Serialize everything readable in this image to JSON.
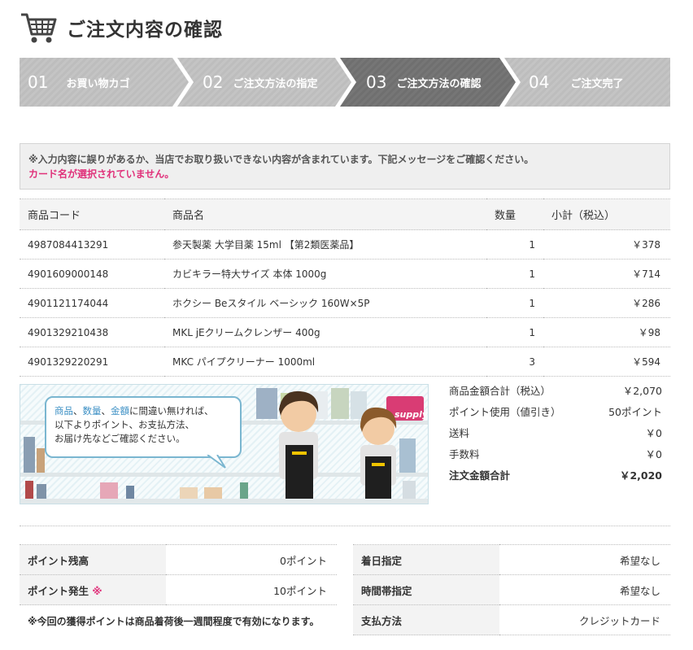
{
  "page": {
    "title": "ご注文内容の確認"
  },
  "steps": [
    {
      "num": "01",
      "label": "お買い物カゴ",
      "active": false
    },
    {
      "num": "02",
      "label": "ご注文方法の指定",
      "active": false
    },
    {
      "num": "03",
      "label": "ご注文方法の確認",
      "active": true
    },
    {
      "num": "04",
      "label": "ご注文完了",
      "active": false
    }
  ],
  "alert": {
    "message": "※入力内容に誤りがあるか、当店でお取り扱いできない内容が含まれています。下記メッセージをご確認ください。",
    "error": "カード名が選択されていません。"
  },
  "items": {
    "headers": {
      "code": "商品コード",
      "name": "商品名",
      "qty": "数量",
      "subtotal": "小計（税込）"
    },
    "rows": [
      {
        "code": "4987084413291",
        "name": "参天製薬 大学目薬 15ml 【第2類医薬品】",
        "qty": "1",
        "subtotal": "￥378"
      },
      {
        "code": "4901609000148",
        "name": "カビキラー特大サイズ 本体 1000g",
        "qty": "1",
        "subtotal": "￥714"
      },
      {
        "code": "4901121174044",
        "name": "ホクシー Beスタイル ベーシック 160W×5P",
        "qty": "1",
        "subtotal": "￥286"
      },
      {
        "code": "4901329210438",
        "name": "MKL jEクリームクレンザー 400g",
        "qty": "1",
        "subtotal": "￥98"
      },
      {
        "code": "4901329220291",
        "name": "MKC パイプクリーナー 1000ml",
        "qty": "3",
        "subtotal": "￥594"
      }
    ]
  },
  "banner": {
    "bubble_hl1": "商品",
    "bubble_sep1": "、",
    "bubble_hl2": "数量",
    "bubble_sep2": "、",
    "bubble_hl3": "金額",
    "bubble_rest1": "に間違い無ければ、",
    "bubble_line2": "以下よりポイント、お支払方法、",
    "bubble_line3": "お届け先などご確認ください。",
    "shelf_text": "supply"
  },
  "totals": [
    {
      "label": "商品金額合計（税込）",
      "value": "￥2,070"
    },
    {
      "label": "ポイント使用（値引き）",
      "value": "50ポイント"
    },
    {
      "label": "送料",
      "value": "￥0"
    },
    {
      "label": "手数料",
      "value": "￥0"
    },
    {
      "label": "注文金額合計",
      "value": "￥2,020"
    }
  ],
  "points": {
    "balance_label": "ポイント残高",
    "balance_value": "0ポイント",
    "earned_label": "ポイント発生",
    "earned_mark": "※",
    "earned_value": "10ポイント",
    "note": "※今回の獲得ポイントは商品着荷後一週間程度で有効になります。"
  },
  "delivery": {
    "date_label": "着日指定",
    "date_value": "希望なし",
    "time_label": "時間帯指定",
    "time_value": "希望なし",
    "payment_label": "支払方法",
    "payment_value": "クレジットカード"
  },
  "colors": {
    "step_inactive": "#bdbdbd",
    "step_active": "#6f6f6f",
    "error": "#e0317a",
    "link": "#3b8fc4"
  }
}
